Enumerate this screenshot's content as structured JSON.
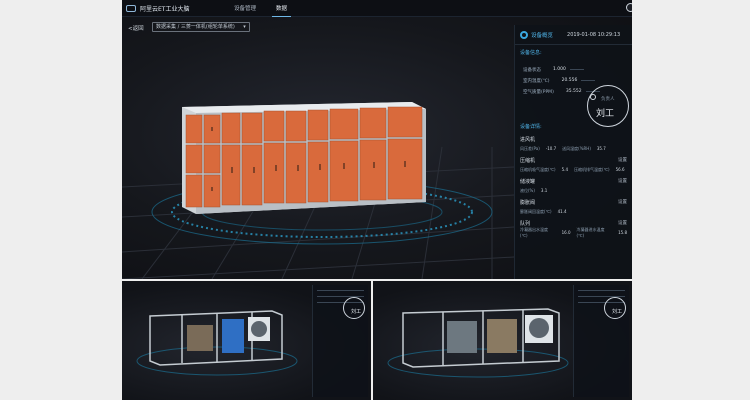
{
  "topbar": {
    "brand": "阿里云ET工业大脑",
    "tabs": [
      {
        "label": "设备管理",
        "active": false
      },
      {
        "label": "数据",
        "active": true
      }
    ]
  },
  "main": {
    "back_label": "<返回",
    "breadcrumb": "数据采集 / 三菱一体机(组轮单系统)"
  },
  "overview": {
    "title": "设备概览",
    "timestamp": "2019-01-08 10:29:13",
    "section_info": "设备信息:",
    "rows": [
      {
        "label": "设备状态",
        "value": "1.000"
      },
      {
        "label": "室内温度(℃)",
        "value": "20.556"
      },
      {
        "label": "空气质量(PPM)",
        "value": "35.552"
      }
    ],
    "owner_label": "负责人",
    "owner_name": "刘工",
    "section_detail": "设备详情:",
    "details": [
      {
        "head": "进风机",
        "set": "",
        "lines": [
          [
            "风压差(Pa)",
            "-10.7"
          ],
          [
            "送风湿度(%RH)",
            "35.7"
          ]
        ]
      },
      {
        "head": "压缩机",
        "set": "设置",
        "lines": [
          [
            "压缩机吸气温度(℃)",
            "5.4"
          ],
          [
            "压缩机排气温度(℃)",
            "56.6"
          ]
        ]
      },
      {
        "head": "储液罐",
        "set": "设置",
        "lines": [
          [
            "液位(%)",
            "3.1"
          ]
        ]
      },
      {
        "head": "膨胀阀",
        "set": "设置",
        "lines": [
          [
            "膨胀阀回温度(℃)",
            "41.4"
          ]
        ]
      },
      {
        "head": "队列",
        "set": "设置",
        "lines": [
          [
            "冷凝器出水温度(℃)",
            "16.0"
          ],
          [
            "冷凝器进水温度(℃)",
            "15.8"
          ]
        ]
      }
    ]
  },
  "mini": {
    "left_owner": "刘工",
    "right_owner": "刘工"
  },
  "colors": {
    "accent": "#3aa8e0",
    "cabinet": "#d96a3c",
    "frame": "#bfc6cc",
    "floor_ring": "#1e7fa6"
  }
}
